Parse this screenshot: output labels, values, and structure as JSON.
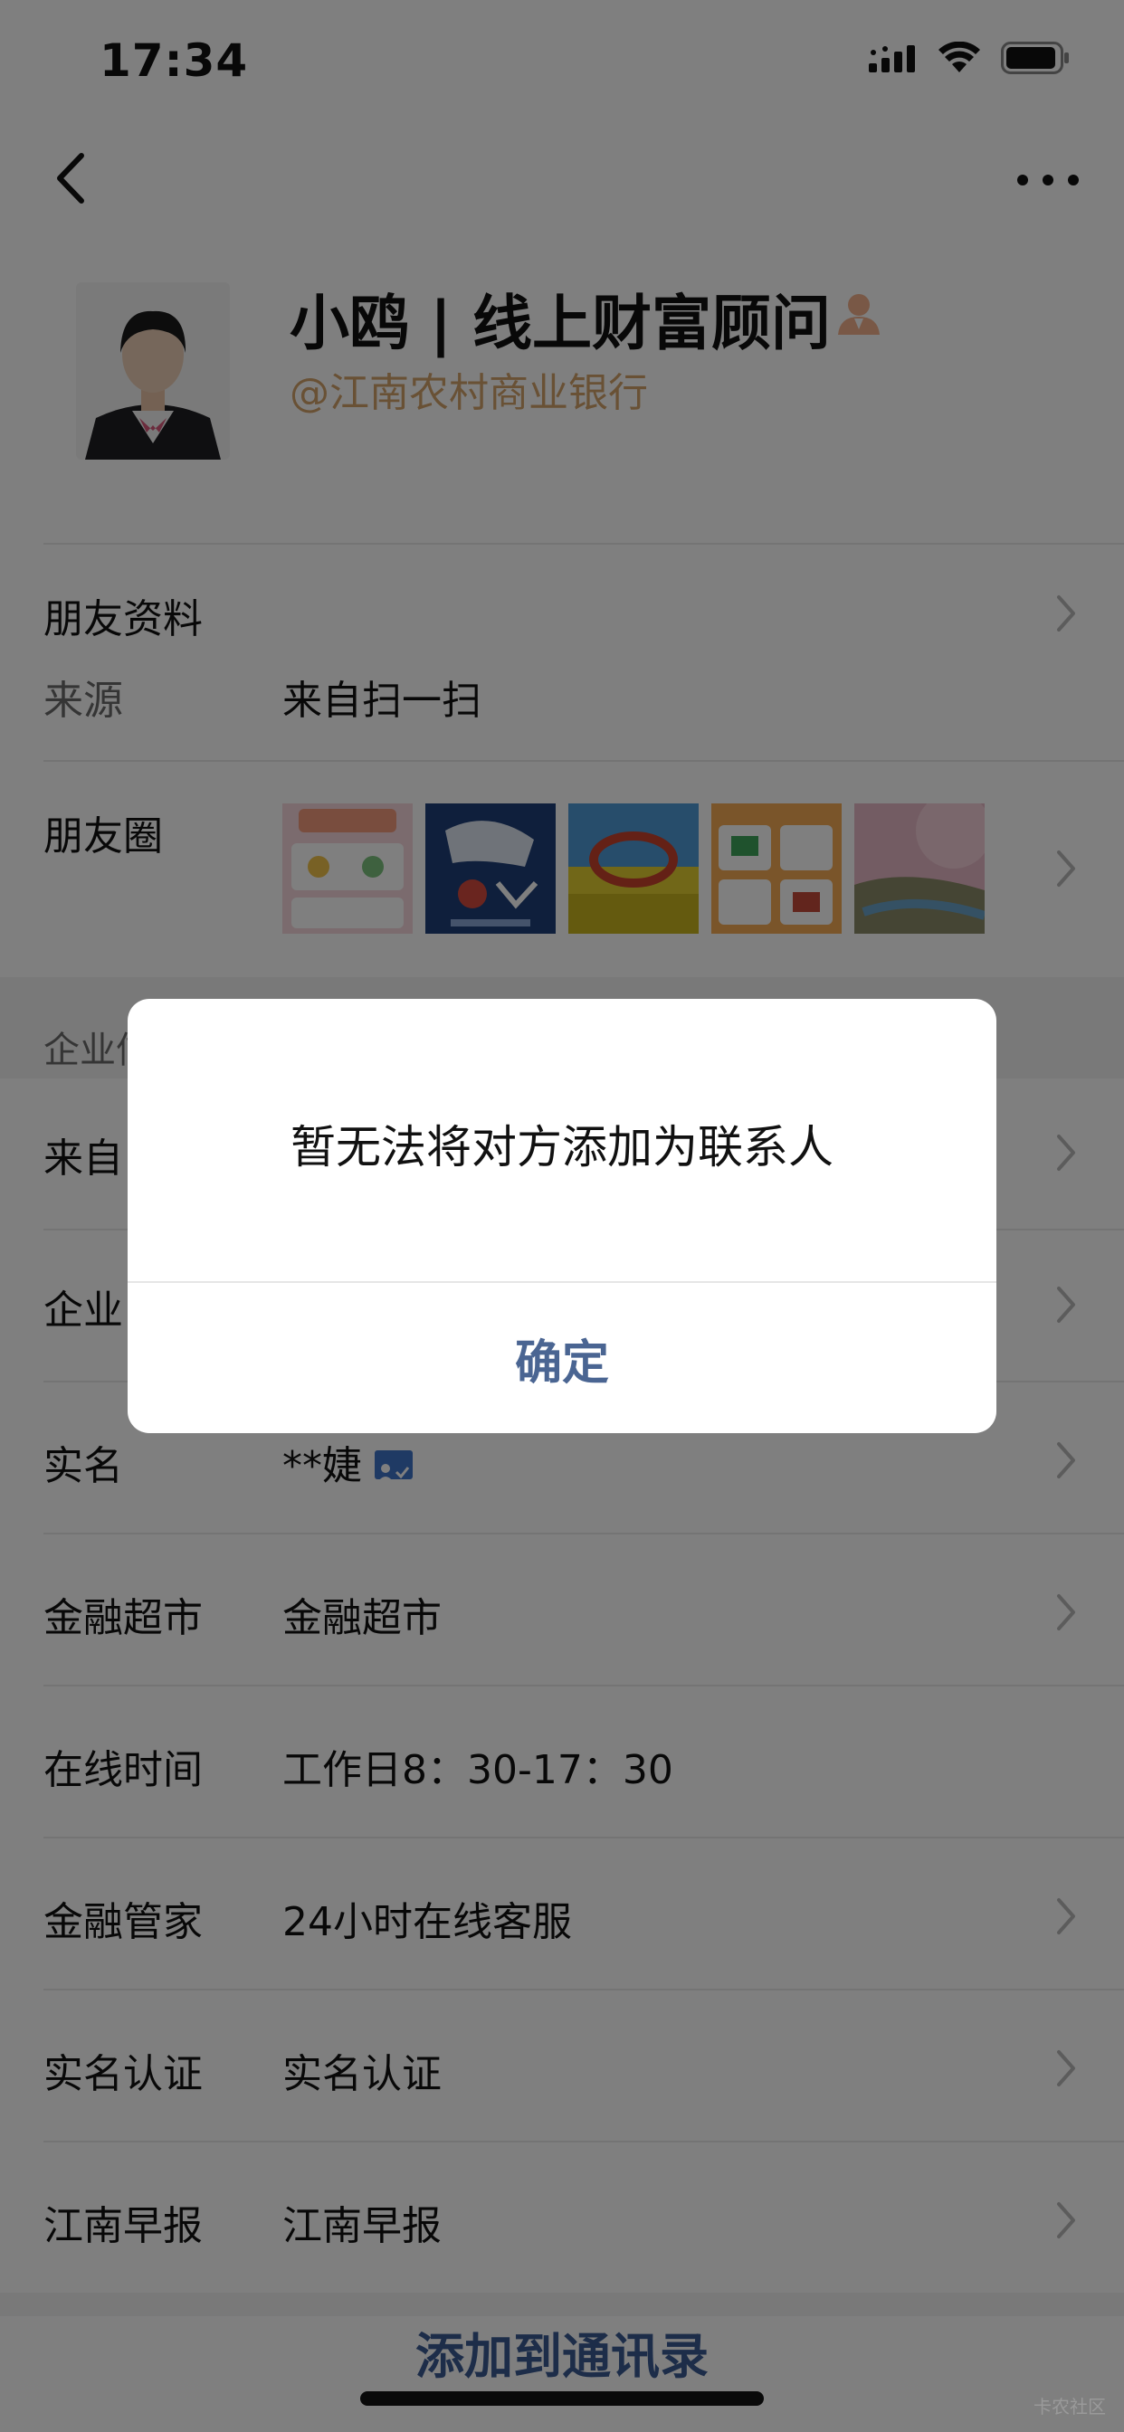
{
  "status_bar": {
    "time": "17:34"
  },
  "profile": {
    "name": "小鸥 | 线上财富顾问",
    "organization": "@江南农村商业银行"
  },
  "rows": {
    "friend_info": {
      "label": "朋友资料"
    },
    "source": {
      "label": "来源",
      "value": "来自扫一扫"
    },
    "moments": {
      "label": "朋友圈"
    },
    "enterprise_section": {
      "title": "企业信"
    },
    "from_row": {
      "label": "来自"
    },
    "enterprise_row": {
      "label": "企业"
    },
    "real_name": {
      "label": "实名",
      "value": "**婕"
    },
    "finance_market": {
      "label": "金融超市",
      "value": "金融超市"
    },
    "online_time": {
      "label": "在线时间",
      "value": "工作日8：30-17：30"
    },
    "finance_butler": {
      "label": "金融管家",
      "value": "24小时在线客服"
    },
    "real_name_auth": {
      "label": "实名认证",
      "value": "实名认证"
    },
    "jiangnan_news": {
      "label": "江南早报",
      "value": "江南早报"
    }
  },
  "add_contact_label": "添加到通讯录",
  "dialog": {
    "message": "暂无法将对方添加为联系人",
    "confirm_label": "确定"
  },
  "watermark": "卡农社区",
  "colors": {
    "org_text": "#d3a26a",
    "dialog_button": "#4a6592",
    "verified_badge": "#3f74c9"
  }
}
